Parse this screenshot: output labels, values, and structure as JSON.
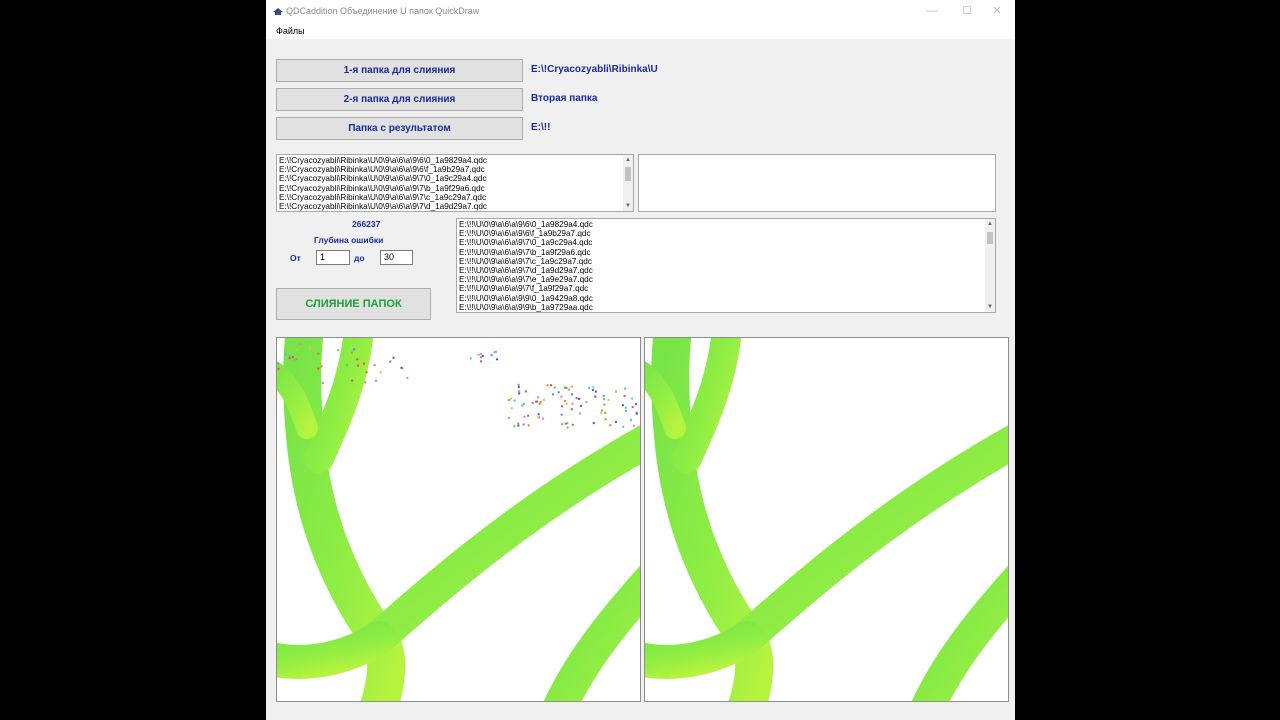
{
  "window": {
    "title": "QDCaddition Объединение U папок QuickDraw",
    "icon": "app-icon",
    "controls": {
      "minimize": "—",
      "maximize": "☐",
      "close": "✕"
    }
  },
  "menu": {
    "items": [
      "Файлы"
    ]
  },
  "folders": {
    "first": {
      "button": "1-я папка для слияния",
      "path": "E:\\!Cryacozyabli\\Ribinka\\U"
    },
    "second": {
      "button": "2-я папка для слияния",
      "path": "Вторая папка"
    },
    "result": {
      "button": "Папка с результатом",
      "path": "E:\\!!"
    }
  },
  "list_first": [
    "E:\\!Cryacozyabli\\Ribinka\\U\\0\\9\\a\\6\\a\\9\\6\\0_1a9829a4.qdc",
    "E:\\!Cryacozyabli\\Ribinka\\U\\0\\9\\a\\6\\a\\9\\6\\f_1a9b29a7.qdc",
    "E:\\!Cryacozyabli\\Ribinka\\U\\0\\9\\a\\6\\a\\9\\7\\0_1a9c29a4.qdc",
    "E:\\!Cryacozyabli\\Ribinka\\U\\0\\9\\a\\6\\a\\9\\7\\b_1a9f29a6.qdc",
    "E:\\!Cryacozyabli\\Ribinka\\U\\0\\9\\a\\6\\a\\9\\7\\c_1a9c29a7.qdc",
    "E:\\!Cryacozyabli\\Ribinka\\U\\0\\9\\a\\6\\a\\9\\7\\d_1a9d29a7.qdc"
  ],
  "list_second": [],
  "list_result": [
    "E:\\!!\\U\\0\\9\\a\\6\\a\\9\\6\\0_1a9829a4.qdc",
    "E:\\!!\\U\\0\\9\\a\\6\\a\\9\\6\\f_1a9b29a7.qdc",
    "E:\\!!\\U\\0\\9\\a\\6\\a\\9\\7\\0_1a9c29a4.qdc",
    "E:\\!!\\U\\0\\9\\a\\6\\a\\9\\7\\b_1a9f29a6.qdc",
    "E:\\!!\\U\\0\\9\\a\\6\\a\\9\\7\\c_1a9c29a7.qdc",
    "E:\\!!\\U\\0\\9\\a\\6\\a\\9\\7\\d_1a9d29a7.qdc",
    "E:\\!!\\U\\0\\9\\a\\6\\a\\9\\7\\e_1a9e29a7.qdc",
    "E:\\!!\\U\\0\\9\\a\\6\\a\\9\\7\\f_1a9f29a7.qdc",
    "E:\\!!\\U\\0\\9\\a\\6\\a\\9\\9\\0_1a9429a8.qdc",
    "E:\\!!\\U\\0\\9\\a\\6\\a\\9\\9\\b_1a9729aa.qdc"
  ],
  "counter": "266237",
  "error_depth": {
    "label": "Глубина ошибки",
    "from_label": "От",
    "from_value": "1",
    "to_label": "до",
    "to_value": "30"
  },
  "merge_button": "СЛИЯНИЕ ПАПОК",
  "colors": {
    "label_blue": "#1a2a9c",
    "merge_green": "#15a43a",
    "stroke_green": "#7fe84a",
    "stroke_light": "#b8f540"
  },
  "scrollbar_icons": {
    "up": "▲",
    "down": "▼"
  }
}
